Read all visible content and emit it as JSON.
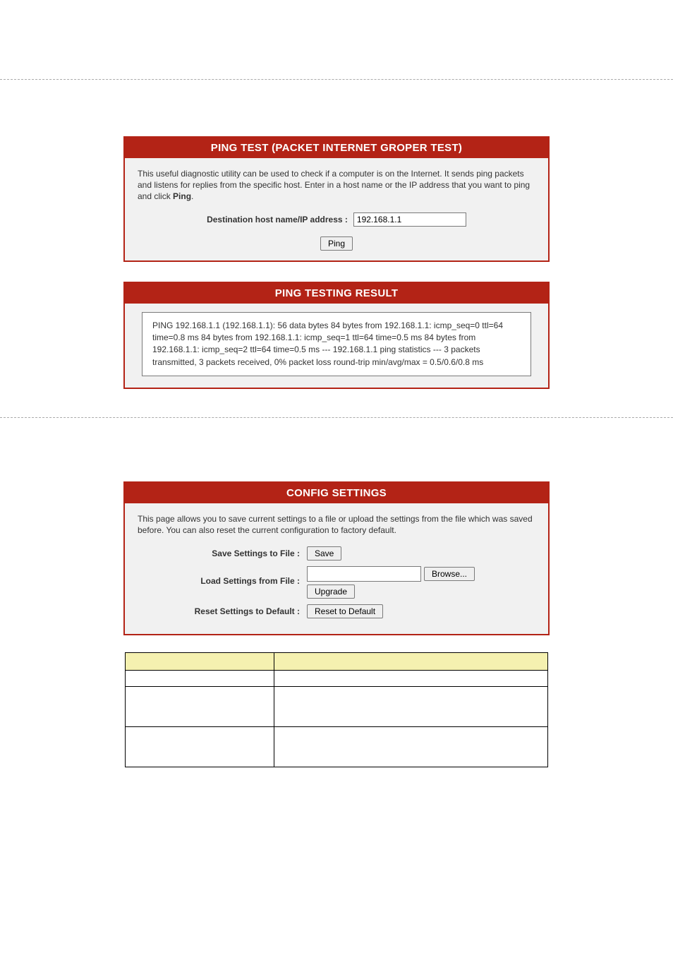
{
  "ping": {
    "title": "PING TEST (PACKET INTERNET GROPER TEST)",
    "desc_a": "This useful diagnostic utility can be used to check if a computer is on the Internet. It sends ping packets and listens for replies from the specific host. Enter in a host name or the IP address that you want to ping and click ",
    "desc_b": "Ping",
    "desc_c": ".",
    "dest_label": "Destination host name/IP address :",
    "dest_value": "192.168.1.1",
    "button": "Ping"
  },
  "result": {
    "title": "PING TESTING RESULT",
    "text": "PING 192.168.1.1 (192.168.1.1): 56 data bytes 84 bytes from 192.168.1.1: icmp_seq=0 ttl=64 time=0.8 ms 84 bytes from 192.168.1.1: icmp_seq=1 ttl=64 time=0.5 ms 84 bytes from 192.168.1.1: icmp_seq=2 ttl=64 time=0.5 ms --- 192.168.1.1 ping statistics --- 3 packets transmitted, 3 packets received, 0% packet loss round-trip min/avg/max = 0.5/0.6/0.8 ms"
  },
  "config": {
    "title": "CONFIG SETTINGS",
    "desc": "This page allows you to save current settings to a file or upload the settings from the file which was saved before. You can also reset the current configuration to factory default.",
    "save_label": "Save Settings to File :",
    "save_btn": "Save",
    "load_label": "Load Settings from File :",
    "browse_btn": "Browse...",
    "upgrade_btn": "Upgrade",
    "reset_label": "Reset Settings to Default :",
    "reset_btn": "Reset to Default"
  }
}
